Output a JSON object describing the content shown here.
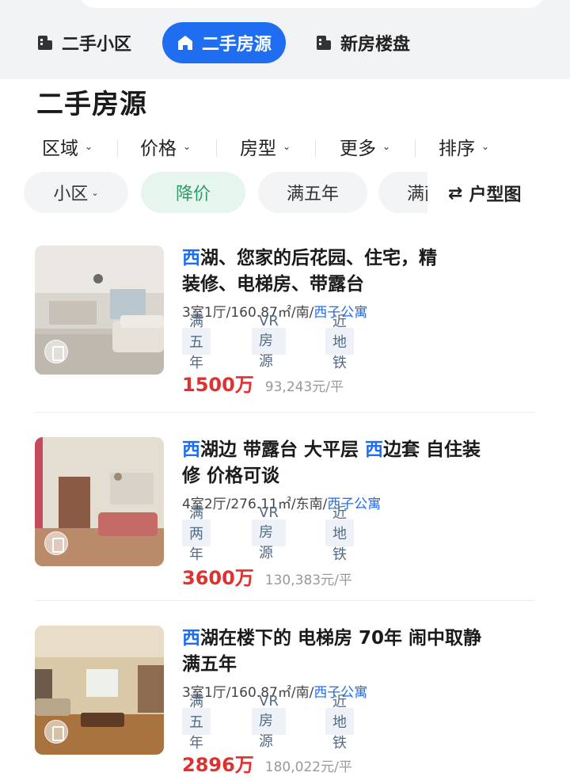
{
  "category_tabs": [
    {
      "label": "二手小区",
      "icon": "building-icon",
      "active": false
    },
    {
      "label": "二手房源",
      "icon": "home-icon",
      "active": true
    },
    {
      "label": "新房楼盘",
      "icon": "building-icon",
      "active": false
    }
  ],
  "page_title": "二手房源",
  "filters": [
    {
      "label": "区域"
    },
    {
      "label": "价格"
    },
    {
      "label": "房型"
    },
    {
      "label": "更多"
    },
    {
      "label": "排序"
    }
  ],
  "chips": [
    {
      "label": "小区",
      "has_dropdown": true,
      "active": false
    },
    {
      "label": "降价",
      "has_dropdown": false,
      "active": true
    },
    {
      "label": "满五年",
      "has_dropdown": false,
      "active": false
    },
    {
      "label": "满两年",
      "has_dropdown": false,
      "active": false
    }
  ],
  "layout_button": {
    "icon": "swap-icon",
    "label": "户型图"
  },
  "listings": [
    {
      "title_hl1": "西",
      "title_part1": "湖、您家的后花园、住宅，精",
      "title_line2": "装修、电梯房、带露台",
      "meta": "3室1厅/160.87㎡/南/",
      "community": "西子公寓",
      "tags": [
        "满五年",
        "VR房源",
        "近地铁"
      ],
      "price": "1500万",
      "unit_price": "93,243元/平"
    },
    {
      "title_hl1": "西",
      "title_part1": "湖边 带露台 大平层 ",
      "title_hl2": "西",
      "title_part2": "边套 自住装",
      "title_line2": "修 价格可谈",
      "meta": "4室2厅/276.11㎡/东南/",
      "community": "西子公寓",
      "tags": [
        "满两年",
        "VR房源",
        "近地铁"
      ],
      "price": "3600万",
      "unit_price": "130,383元/平"
    },
    {
      "title_hl1": "西",
      "title_part1": "湖在楼下的 电梯房 70年 闹中取静",
      "title_line2": "满五年",
      "meta": "3室1厅/160.87㎡/南/",
      "community": "西子公寓",
      "tags": [
        "满五年",
        "VR房源",
        "近地铁"
      ],
      "price": "2896万",
      "unit_price": "180,022元/平"
    }
  ],
  "colors": {
    "accent": "#1f6ef2",
    "price": "#e03131",
    "chip_active_text": "#2f9a6a",
    "chip_active_bg": "#e7f5ef"
  }
}
